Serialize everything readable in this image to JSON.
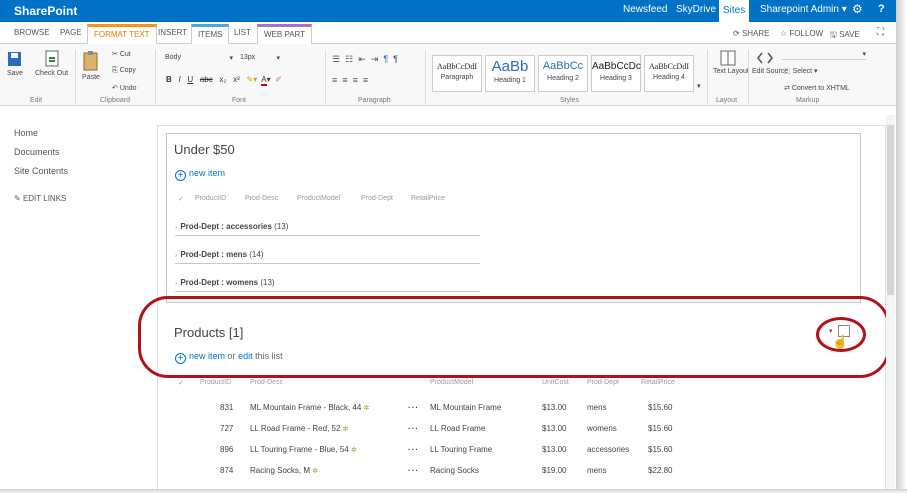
{
  "topbar": {
    "brand": "SharePoint",
    "links": [
      "Newsfeed",
      "SkyDrive",
      "Sites"
    ],
    "user": "Sharepoint Admin",
    "color": "#0072c6"
  },
  "tabs": {
    "items": [
      "BROWSE",
      "PAGE",
      "FORMAT TEXT",
      "INSERT",
      "ITEMS",
      "LIST",
      "WEB PART"
    ],
    "actions": [
      "SHARE",
      "FOLLOW",
      "SAVE"
    ]
  },
  "ribbon": {
    "edit": {
      "save": "Save",
      "checkout": "Check Out",
      "label": "Edit"
    },
    "clipboard": {
      "paste": "Paste",
      "cut": "Cut",
      "copy": "Copy",
      "undo": "Undo",
      "label": "Clipboard"
    },
    "font": {
      "family": "Body",
      "size": "13px",
      "label": "Font"
    },
    "paragraph": {
      "label": "Paragraph"
    },
    "styles": {
      "label": "Styles",
      "items": [
        {
          "sample": "AaBbCcDdI",
          "name": "Paragraph"
        },
        {
          "sample": "AaBb",
          "name": "Heading 1"
        },
        {
          "sample": "AaBbCc",
          "name": "Heading 2"
        },
        {
          "sample": "AaBbCcDc",
          "name": "Heading 3"
        },
        {
          "sample": "AaBbCcDdI",
          "name": "Heading 4"
        }
      ]
    },
    "layout": {
      "text_layout": "Text Layout",
      "label": "Layout"
    },
    "markup": {
      "edit_source": "Edit Source",
      "select": "Select",
      "convert": "Convert to XHTML",
      "label": "Markup"
    }
  },
  "sidebar": {
    "items": [
      "Home",
      "Documents",
      "Site Contents"
    ],
    "edit_links": "EDIT LINKS"
  },
  "webpart1": {
    "title": "Under $50",
    "new_item": "new item",
    "columns": [
      "ProductID",
      "Prod-Desc",
      "ProductModel",
      "Prod-Dept",
      "RetailPrice"
    ],
    "groups": [
      {
        "label": "Prod-Dept : accessories",
        "count": "(13)"
      },
      {
        "label": "Prod-Dept : mens",
        "count": "(14)"
      },
      {
        "label": "Prod-Dept : womens",
        "count": "(13)"
      }
    ]
  },
  "webpart2": {
    "title": "Products [1]",
    "new_item": "new item",
    "or_text": "or",
    "edit_text": "edit",
    "this_list": "this list",
    "columns": [
      "ProductID",
      "Prod-Desc",
      "ProductModel",
      "UnitCost",
      "Prod-Dept",
      "RetailPrice"
    ],
    "rows": [
      {
        "id": "831",
        "desc": "ML Mountain Frame - Black, 44",
        "model": "ML Mountain Frame",
        "cost": "$13.00",
        "dept": "mens",
        "price": "$15.60"
      },
      {
        "id": "727",
        "desc": "LL Road Frame - Red, 52",
        "model": "LL Road Frame",
        "cost": "$13.00",
        "dept": "womens",
        "price": "$15.60"
      },
      {
        "id": "896",
        "desc": "LL Touring Frame - Blue, 54",
        "model": "LL Touring Frame",
        "cost": "$13.00",
        "dept": "accessories",
        "price": "$15.60"
      },
      {
        "id": "874",
        "desc": "Racing Socks, M",
        "model": "Racing Socks",
        "cost": "$19.00",
        "dept": "mens",
        "price": "$22.80"
      }
    ]
  },
  "annotation_color": "#b3121a"
}
